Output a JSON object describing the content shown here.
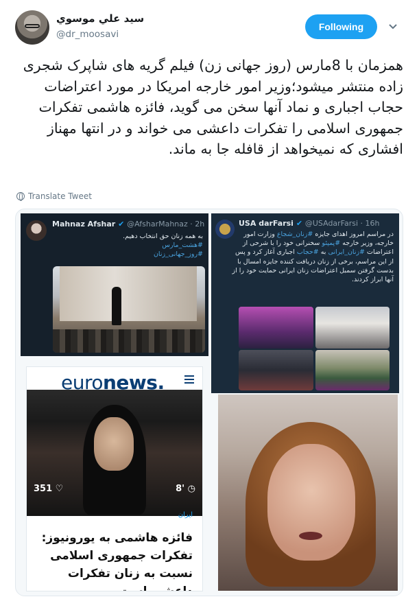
{
  "tweet": {
    "author_name": "سید علي موسوي",
    "author_handle": "@dr_moosavi",
    "follow_label": "Following",
    "text": "همزمان با 8مارس (روز جهانی زن) فیلم گریه های شاپرک شجری زاده منتشر میشود؛وزیر امور خارجه امریکا در مورد اعتراضات حجاب اجباری و نماد آنها سخن می گوید، فائزه هاشمی تفکرات جمهوری اسلامی را تفکرات داعشی می خواند و در انتها مهناز افشاری که نمیخواهد از قافله جا به ماند.",
    "translate_label": "Translate Tweet"
  },
  "colors": {
    "accent": "#1da1f2",
    "text": "#14171a",
    "muted": "#657786",
    "dark_tweet_bg": "#15202b",
    "euronews_blue": "#0a3d73"
  },
  "icons": {
    "chevron": "chevron-down-icon",
    "translate": "globe-icon",
    "verified": "verified-badge-icon",
    "menu": "hamburger-menu-icon",
    "heart": "heart-icon",
    "clock": "clock-icon"
  },
  "media": {
    "afshar": {
      "name": "Mahnaz Afshar",
      "handle_time": "@AfsharMahnaz · 2h",
      "line1": "به همه زنان حق انتخاب دهیم.",
      "tag1": "#هشت_مارس",
      "tag2": "#روز_جهانی_زنان"
    },
    "usa": {
      "name": "USA darFarsi",
      "handle_time": "@USAdarFarsi · 16h",
      "text_a": "در مراسم امروز اهدای جایزه ",
      "tag_a": "#زنان_شجاع",
      "text_b": " وزارت امور خارجه، وزیر خارجه ",
      "tag_b": "#پمپئو",
      "text_c": " سخنرانی خود را با شرحی از اعتراضات ",
      "tag_c": "#زنان_ایرانی",
      "text_d": " به ",
      "tag_d": "#حجاب",
      "text_e": " اجباری آغاز کرد و پس از این مراسم، برخی از زنان دریافت کننده جایزه امسال با بدست گرفتن سمبل اعتراضات زنان ایرانی حمایت خود را از آنها ابراز کردند."
    },
    "euronews": {
      "brand_a": "euro",
      "brand_b": "news.",
      "likes": "351",
      "time": "8'",
      "category": "ایران",
      "headline": "فائزه هاشمی به یورونیوز: تفکرات جمهوری اسلامی نسبت به زنان تفکرات داعشی است"
    }
  }
}
